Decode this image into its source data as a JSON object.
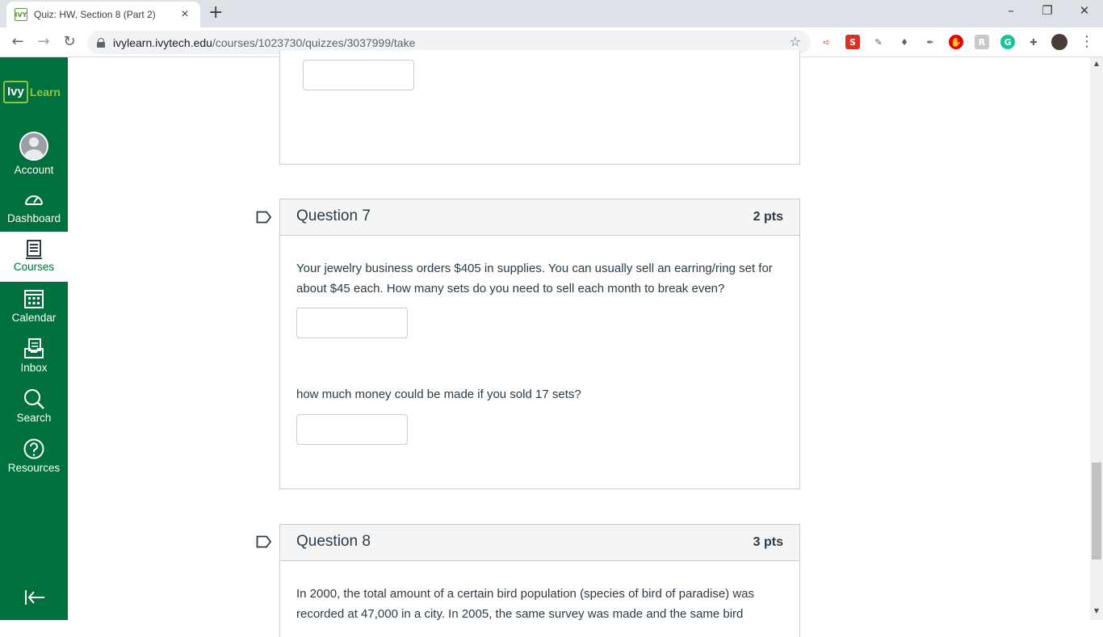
{
  "browser": {
    "tab_title": "Quiz: HW, Section 8 (Part 2)",
    "tab_close": "×",
    "new_tab": "+",
    "favicon_text": "IVY",
    "url_domain": "ivylearn.ivytech.edu",
    "url_path": "/courses/1023730/quizzes/3037999/take",
    "minimize": "–",
    "restore": "❐",
    "close": "✕",
    "back": "←",
    "forward": "→",
    "reload": "↻",
    "star": "☆",
    "menu": "⋮"
  },
  "nav": {
    "logo_ivy": "Ivy",
    "logo_learn": "Learn",
    "items": [
      {
        "label": "Account",
        "icon": "avatar-icon"
      },
      {
        "label": "Dashboard",
        "icon": "dashboard-icon"
      },
      {
        "label": "Courses",
        "icon": "courses-icon"
      },
      {
        "label": "Calendar",
        "icon": "calendar-icon"
      },
      {
        "label": "Inbox",
        "icon": "inbox-icon"
      },
      {
        "label": "Search",
        "icon": "search-icon"
      },
      {
        "label": "Resources",
        "icon": "help-icon"
      }
    ]
  },
  "questions": [
    {
      "title": "Question 7",
      "points": "2 pts",
      "text1": "Your jewelry business orders $405 in supplies. You can usually sell an earring/ring set for about $45 each. How many sets do you need to sell each month to break even?",
      "text2": "how much money could be made if you sold 17 sets?"
    },
    {
      "title": "Question 8",
      "points": "3 pts",
      "text1": "In 2000, the total amount of a certain bird population (species of bird of paradise) was recorded at 47,000 in a city. In 2005, the same survey was made and the same bird"
    }
  ],
  "colors": {
    "nav_green": "#00713e",
    "logo_green": "#8cc63f",
    "text": "#2d3b45"
  }
}
